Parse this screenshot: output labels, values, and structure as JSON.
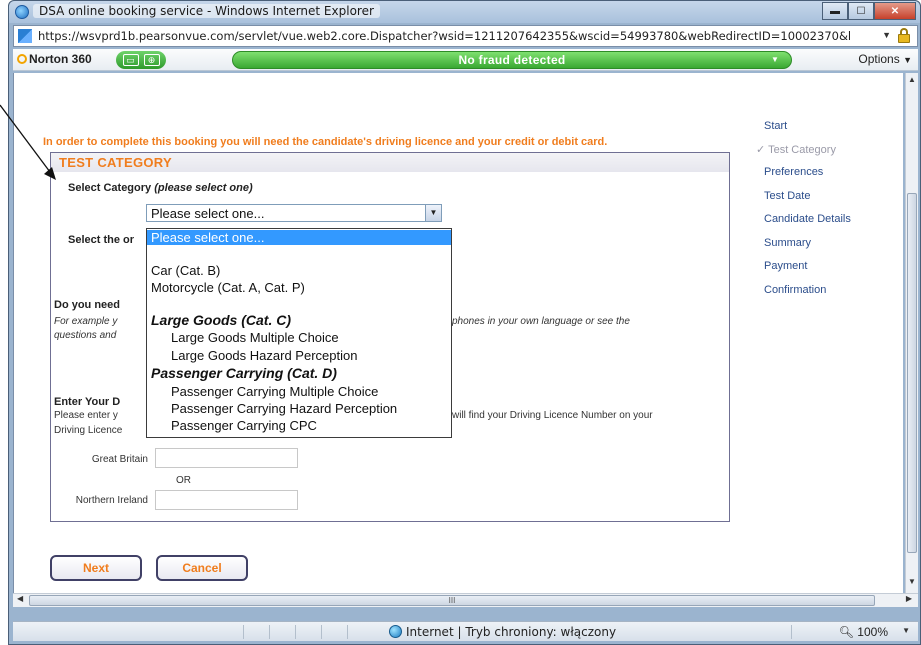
{
  "window": {
    "title": "DSA online booking service - Windows Internet Explorer",
    "controls": {
      "minimize": "▬",
      "maximize": "☐",
      "close": "✕"
    }
  },
  "addressbar": {
    "url": "https://wsvprd1b.pearsonvue.com/servlet/vue.web2.core.Dispatcher?wsid=1211207642355&wscid=54993780&webRedirectID=10002370&l",
    "dropdown": "▼"
  },
  "norton": {
    "brand": "Norton 360",
    "status": "No fraud detected",
    "options": "Options",
    "options_arrow": "▼"
  },
  "page": {
    "intro": "In order to complete this booking you will need the candidate's driving licence and your credit or debit card.",
    "section_title": "TEST CATEGORY",
    "select_category_label": "Select Category",
    "select_category_hint": "(please select one)",
    "select_value": "Please select one...",
    "select_arrow": "▼",
    "select_other_label": "Select the or",
    "do_you_need_label": "Do you need",
    "for_example_text": "For example y",
    "for_example_tail": "phones in your own language or see the",
    "questions_text": "questions and",
    "enter_label": "Enter Your D",
    "please_enter_text": "Please enter y",
    "will_find_text": "will find your Driving Licence Number on your",
    "driving_licence_text": "Driving Licence",
    "great_britain_label": "Great Britain",
    "or_label": "OR",
    "northern_ireland_label": "Northern Ireland"
  },
  "dropdown": {
    "options": [
      {
        "label": "Please select one...",
        "kind": "selected"
      },
      {
        "label": "Car (Cat. B)",
        "kind": "option"
      },
      {
        "label": "Motorcycle (Cat. A, Cat. P)",
        "kind": "option"
      },
      {
        "label": "Large Goods (Cat. C)",
        "kind": "group"
      },
      {
        "label": "Large Goods Multiple Choice",
        "kind": "child"
      },
      {
        "label": "Large Goods Hazard Perception",
        "kind": "child"
      },
      {
        "label": "Passenger Carrying (Cat. D)",
        "kind": "group"
      },
      {
        "label": "Passenger Carrying Multiple Choice",
        "kind": "child"
      },
      {
        "label": "Passenger Carrying Hazard Perception",
        "kind": "child"
      },
      {
        "label": "Passenger Carrying CPC",
        "kind": "child"
      }
    ]
  },
  "buttons": {
    "next": "Next",
    "cancel": "Cancel"
  },
  "sidenav": {
    "items": [
      {
        "label": "Start",
        "done": false
      },
      {
        "label": "Test Category",
        "done": true,
        "check": "✓"
      },
      {
        "label": "Preferences",
        "done": false
      },
      {
        "label": "Test Date",
        "done": false
      },
      {
        "label": "Candidate Details",
        "done": false
      },
      {
        "label": "Summary",
        "done": false
      },
      {
        "label": "Payment",
        "done": false
      },
      {
        "label": "Confirmation",
        "done": false
      }
    ]
  },
  "statusbar": {
    "zone": "Internet | Tryb chroniony: włączony",
    "zoom": "100%",
    "zoom_arrow": "▼"
  },
  "scrollbars": {
    "h_thumb_grip": "III"
  },
  "colors": {
    "accent_orange": "#f07d1e",
    "nav_blue": "#2b4d8b",
    "selection_blue": "#3399ff",
    "norton_green": "#3aa832"
  }
}
